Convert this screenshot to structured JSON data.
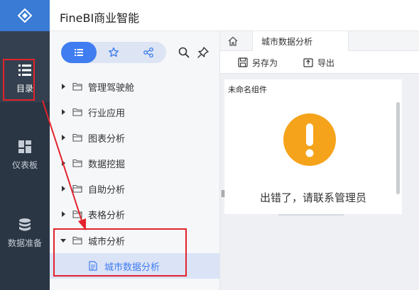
{
  "app": {
    "title": "FineBI商业智能"
  },
  "rail": {
    "items": [
      {
        "label": "目录",
        "icon": "list-icon"
      },
      {
        "label": "仪表板",
        "icon": "dashboard-icon"
      },
      {
        "label": "数据准备",
        "icon": "database-icon"
      }
    ]
  },
  "catalog": {
    "tree": [
      {
        "label": "管理驾驶舱",
        "expanded": false
      },
      {
        "label": "行业应用",
        "expanded": false
      },
      {
        "label": "图表分析",
        "expanded": false
      },
      {
        "label": "数据挖掘",
        "expanded": false
      },
      {
        "label": "自助分析",
        "expanded": false
      },
      {
        "label": "表格分析",
        "expanded": false
      },
      {
        "label": "城市分析",
        "expanded": true
      }
    ],
    "child": {
      "label": "城市数据分析"
    }
  },
  "main": {
    "tab_label": "城市数据分析",
    "toolbar": {
      "save_as": "另存为",
      "export": "导出"
    },
    "widget": {
      "title": "未命名组件",
      "error_message": "出错了，请联系管理员"
    }
  },
  "colors": {
    "rail_bg": "#2b3645",
    "accent": "#3f7df0",
    "error_orange": "#f5a31a",
    "annotation_red": "#e3222b"
  }
}
